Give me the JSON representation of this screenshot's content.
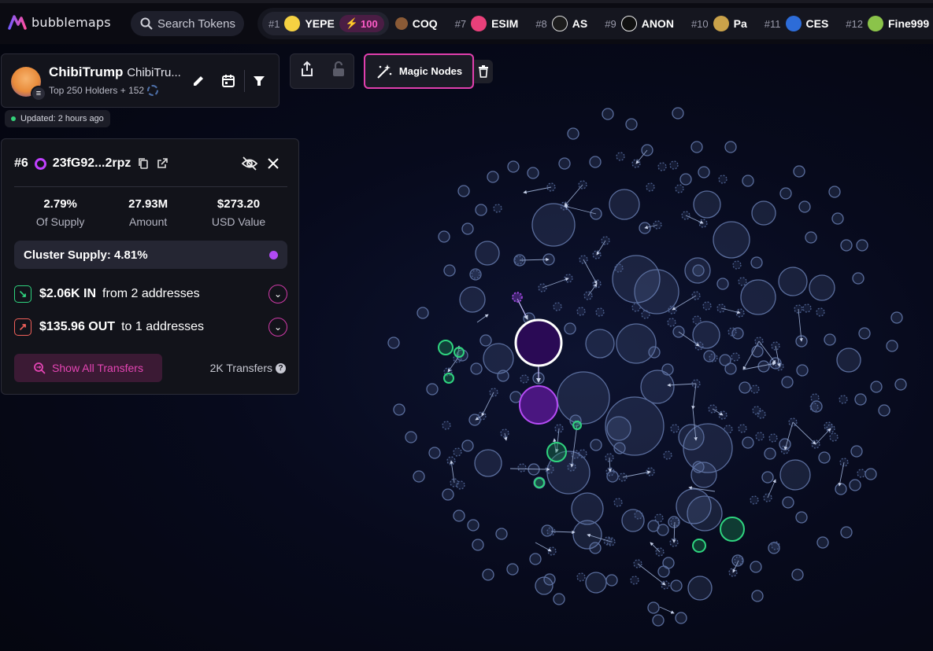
{
  "app": {
    "logo_text": "bubblemaps"
  },
  "search": {
    "label": "Search Tokens"
  },
  "ticker": [
    {
      "rank": "#1",
      "symbol": "YEPE",
      "color": "#f5d142",
      "boost": "100"
    },
    {
      "rank": "",
      "symbol": "COQ",
      "color": "#b07a4a"
    },
    {
      "rank": "#7",
      "symbol": "ESIM",
      "color": "#e9407a"
    },
    {
      "rank": "#8",
      "symbol": "AS",
      "color": "#1c1c1c"
    },
    {
      "rank": "#9",
      "symbol": "ANON",
      "color": "#101010"
    },
    {
      "rank": "#10",
      "symbol": "Pa",
      "color": "#caa24a"
    },
    {
      "rank": "#11",
      "symbol": "CES",
      "color": "#2d6cd8"
    },
    {
      "rank": "#12",
      "symbol": "Fine999",
      "color": "#8bc34a"
    }
  ],
  "token": {
    "name": "ChibiTrump",
    "sub": "ChibiTru...",
    "holders": "Top 250 Holders + 152",
    "updated": "Updated: 2 hours ago"
  },
  "toolbar": {
    "magic_label": "Magic Nodes"
  },
  "wallet": {
    "rank": "#6",
    "address": "23fG92...2rpz",
    "stats": [
      {
        "value": "2.79%",
        "label": "Of Supply"
      },
      {
        "value": "27.93M",
        "label": "Amount"
      },
      {
        "value": "$273.20",
        "label": "USD Value"
      }
    ],
    "cluster": "Cluster Supply: 4.81%",
    "in_amount": "$2.06K IN",
    "in_text": "from 2 addresses",
    "out_amount": "$135.96 OUT",
    "out_text": "to 1 addresses",
    "show_all": "Show All Transfers",
    "transfers": "2K Transfers"
  },
  "colors": {
    "accent": "#e13fae",
    "selected": "#6a1fa8",
    "cluster_green": "#2fd47f",
    "bubble_stroke": "#5a6d9c"
  }
}
